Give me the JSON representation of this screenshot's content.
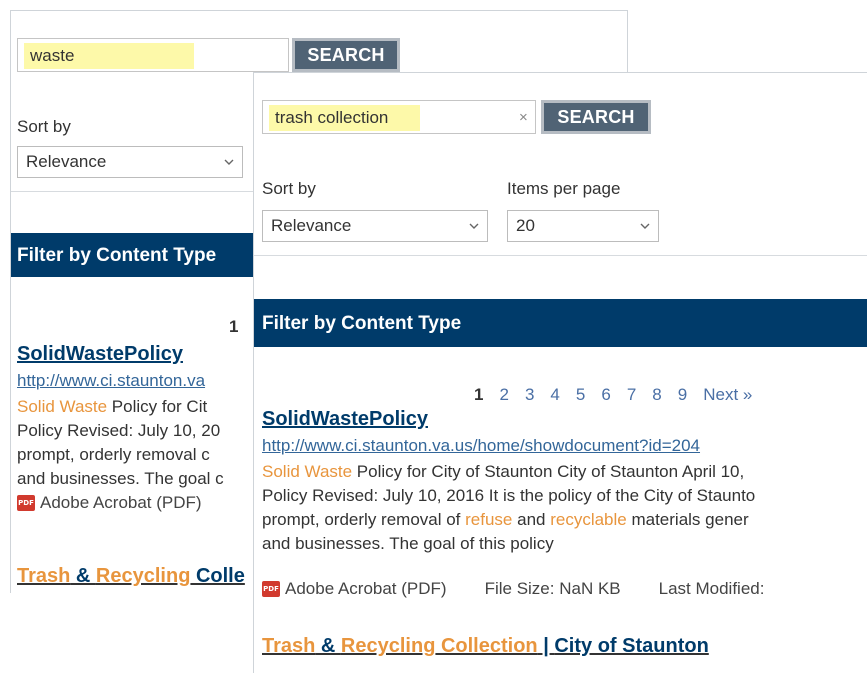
{
  "back": {
    "search_value": "waste",
    "search_button": "SEARCH",
    "sort_label": "Sort by",
    "sort_value": "Relevance",
    "filter_heading": "Filter by Content Type",
    "pager_current": "1",
    "result": {
      "title": "SolidWastePolicy",
      "url": "http://www.ci.staunton.va",
      "hl1": "Solid Waste",
      "line1_rest": " Policy for Cit",
      "line2": "Policy Revised: July 10, 20",
      "line3": "prompt, orderly removal c",
      "line4": "and businesses. The goal c",
      "file_type": "Adobe Acrobat (PDF)"
    },
    "next_title": {
      "w1": "Trash",
      "amp": " & ",
      "w2": "Recycling",
      "w3": " Colle"
    }
  },
  "front": {
    "search_value": "trash collection",
    "clear_glyph": "×",
    "search_button": "SEARCH",
    "sort_label": "Sort by",
    "sort_value": "Relevance",
    "items_label": "Items per page",
    "items_value": "20",
    "filter_heading": "Filter by Content Type",
    "pager": [
      "1",
      "2",
      "3",
      "4",
      "5",
      "6",
      "7",
      "8",
      "9",
      "Next »"
    ],
    "result": {
      "title": "SolidWastePolicy",
      "url": "http://www.ci.staunton.va.us/home/showdocument?id=204",
      "line1_hl": "Solid Waste",
      "line1_rest": " Policy for City of Staunton City of Staunton April 10,",
      "line2": "Policy Revised: July 10, 2016 It is the policy of the City of Staunto",
      "line3_a": "prompt, orderly removal of ",
      "line3_hl1": "refuse",
      "line3_b": " and ",
      "line3_hl2": "recyclable",
      "line3_c": " materials gener",
      "line4": "and businesses. The goal of this policy",
      "file_type": "Adobe Acrobat (PDF)",
      "file_size": "File Size: NaN KB",
      "last_modified": "Last Modified:"
    },
    "next_title": {
      "w1": "Trash",
      "amp": " & ",
      "w2": "Recycling",
      "w3": " Collection",
      "sep": " | ",
      "w4": "City of Staunton"
    }
  },
  "colors": {
    "accent_dark": "#003b6a",
    "button": "#506375",
    "highlight": "#fdf9a9",
    "keyword": "#e8953d"
  },
  "icons": [
    "chevron-down-icon",
    "pdf-icon",
    "clear-icon"
  ]
}
